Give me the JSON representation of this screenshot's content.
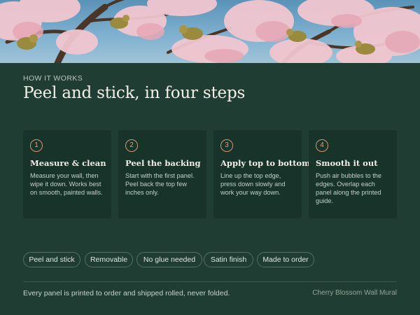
{
  "section": {
    "eyebrow": "HOW IT WORKS",
    "title": "Peel and stick, in four steps"
  },
  "steps": [
    {
      "number": "1",
      "title": "Measure & clean",
      "text": "Measure your wall, then wipe it down. Works best on smooth, painted walls."
    },
    {
      "number": "2",
      "title": "Peel the backing",
      "text": "Start with the first panel. Peel back the top few inches only."
    },
    {
      "number": "3",
      "title": "Apply top to bottom",
      "text": "Line up the top edge, press down slowly and work your way down."
    },
    {
      "number": "4",
      "title": "Smooth it out",
      "text": "Push air bubbles to the edges. Overlap each panel along the printed guide."
    }
  ],
  "tags": [
    "Peel and stick",
    "Removable",
    "No glue needed",
    "Satin finish",
    "Made to order"
  ],
  "footer": {
    "note": "Every panel is printed to order and shipped rolled, never folded.",
    "product": "Cherry Blossom Wall Mural"
  },
  "colors": {
    "background": "#1f3d33",
    "card": "#17332a",
    "accent": "#d4976b",
    "sky": "#6fa6c8",
    "blossom": "#f1c6cf"
  }
}
